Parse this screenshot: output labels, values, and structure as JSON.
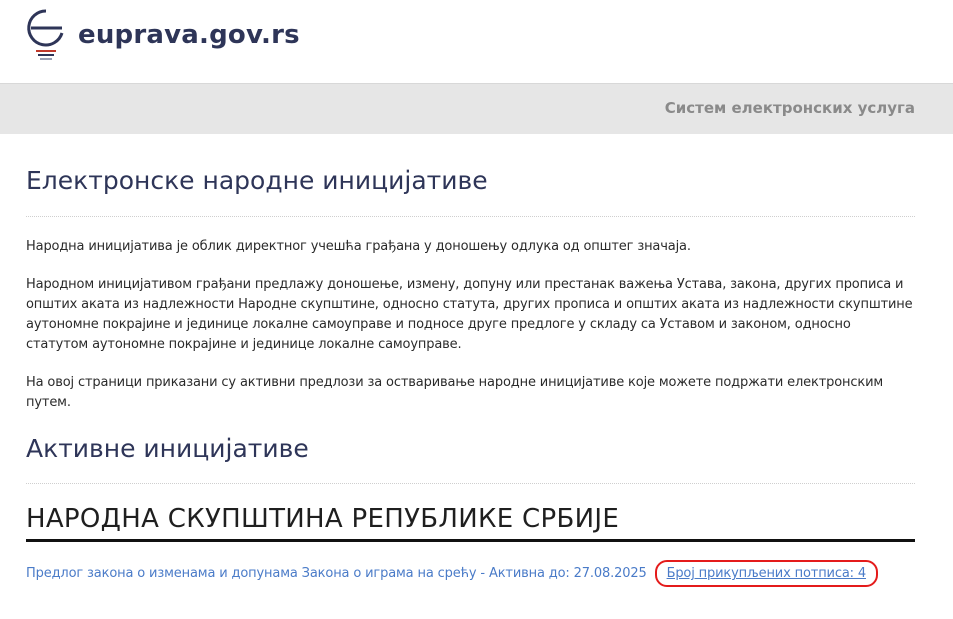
{
  "header": {
    "site_name": "euprava.gov.rs",
    "logo_icon": "euprava-logo-icon"
  },
  "subbar": {
    "title": "Систем електронских услуга"
  },
  "page": {
    "title": "Електронске народне иницијативе",
    "paragraphs": [
      "Народна иницијатива је облик директног учешћа грађана у доношењу одлука од општег значаја.",
      "Народном иницијативом грађани предлажу доношење, измену, допуну или престанак важења Устава, закона, других прописа и општих аката из надлежности Народне скупштине, односно статута, других прописа и општих аката из надлежности скупштине аутономне покрајине и јединице локалне самоуправе и подносе друге предлоге у складу са Уставом и законом, односно статутом аутономне покрајине и јединице локалне самоуправе.",
      "На овој страници приказани су активни предлози за остваривање народне иницијативе које можете подржати електронским путем."
    ],
    "active_title": "Активне иницијативе"
  },
  "initiatives": {
    "org_title": "НАРОДНА СКУПШТИНА РЕПУБЛИКЕ СРБИЈЕ",
    "items": [
      {
        "link_text": "Предлог закона о изменама и допунама Закона о играма на срећу - Активна до: 27.08.2025",
        "signatures_text": "Број прикупљених потписа: 4"
      }
    ]
  },
  "colors": {
    "brand": "#2e3558",
    "link": "#4a7bc8",
    "highlight": "#e41b1b",
    "subbar_bg": "#e6e6e6"
  }
}
